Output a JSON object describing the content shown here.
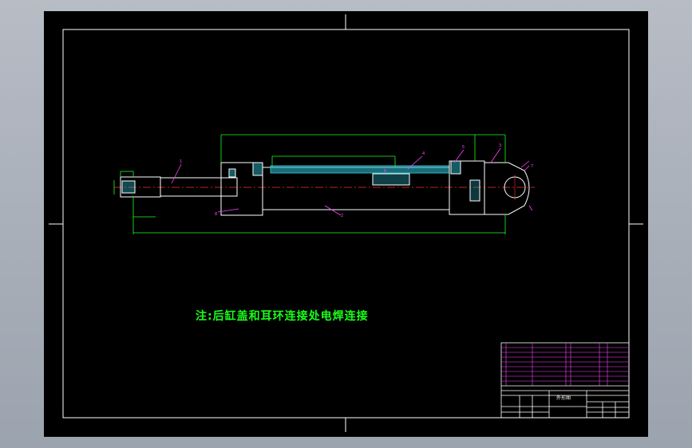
{
  "drawing": {
    "note": "注:后缸盖和耳环连接处电焊连接",
    "part_numbers": [
      "1",
      "2",
      "3",
      "4",
      "5",
      "6",
      "7",
      "8"
    ],
    "title_block": {
      "title": "外形图"
    }
  },
  "colors": {
    "background": "#000000",
    "frame": "#ffffff",
    "outline": "#ffffff",
    "dimension": "#1aff1a",
    "leader": "#ff44ff",
    "centerline": "#ff3030",
    "hatch": "#29b6c8"
  }
}
